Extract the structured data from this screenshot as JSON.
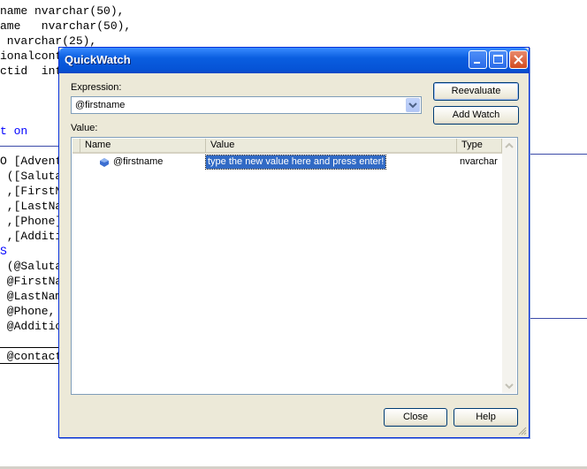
{
  "background_code": [
    {
      "text": "name nvarchar(50),",
      "kw": false
    },
    {
      "text": "ame   nvarchar(50),",
      "kw": false
    },
    {
      "text": " nvarchar(25),",
      "kw": false
    },
    {
      "text": "ionalcont",
      "kw": false
    },
    {
      "text": "ctid  int",
      "kw": false
    },
    {
      "text": "t on",
      "kw": true
    },
    {
      "text": "O [Advent",
      "kw": false
    },
    {
      "text": " ([Saluta",
      "kw": false
    },
    {
      "text": " ,[FirstN",
      "kw": false
    },
    {
      "text": " ,[LastNa",
      "kw": false
    },
    {
      "text": " ,[Phone]",
      "kw": false
    },
    {
      "text": " ,[Additi",
      "kw": false
    },
    {
      "text": "S",
      "kw": true
    },
    {
      "text": " (@Saluta",
      "kw": false
    },
    {
      "text": " @FirstNa",
      "kw": false
    },
    {
      "text": " @LastNam",
      "kw": false
    },
    {
      "text": " @Phone, ",
      "kw": false
    },
    {
      "text": " @Additio",
      "kw": false
    },
    {
      "text": " @contact",
      "kw": false
    }
  ],
  "dialog": {
    "title": "QuickWatch",
    "expression_label": "Expression:",
    "expression_value": "@firstname",
    "value_label": "Value:",
    "reevaluate_label": "Reevaluate",
    "add_watch_label": "Add Watch",
    "close_label": "Close",
    "help_label": "Help",
    "columns": {
      "name": "Name",
      "value": "Value",
      "type": "Type"
    },
    "rows": [
      {
        "name": "@firstname",
        "value": "type the new value here and press enter!",
        "type": "nvarchar"
      }
    ]
  },
  "colors": {
    "titlebar": "#0a5ee0",
    "selection": "#316ac5",
    "keyword": "#0000ff"
  }
}
